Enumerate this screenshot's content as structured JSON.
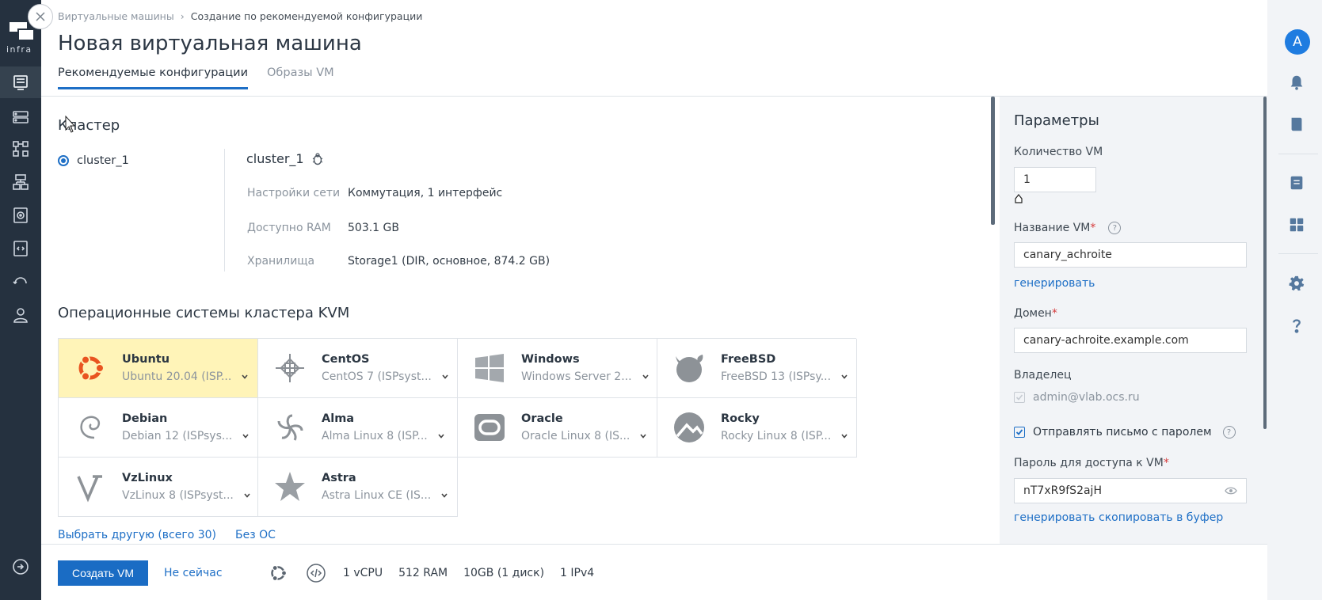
{
  "brand": {
    "logo_text": "infra"
  },
  "left_nav": [
    "vms-icon",
    "servers-icon",
    "network-icon",
    "cluster-icon",
    "images-icon",
    "scripts-icon",
    "backup-icon",
    "users-icon"
  ],
  "breadcrumb": {
    "parent": "Виртуальные машины",
    "separator": "›",
    "current": "Создание по рекомендуемой конфигурации"
  },
  "page_title": "Новая виртуальная машина",
  "tabs": [
    {
      "label": "Рекомендуемые конфигурации",
      "active": true
    },
    {
      "label": "Образы VM",
      "active": false
    }
  ],
  "cluster": {
    "section_title": "Кластер",
    "option_label": "cluster_1",
    "name": "cluster_1",
    "details": [
      {
        "key": "Настройки сети",
        "value": "Коммутация, 1 интерфейс"
      },
      {
        "key": "Доступно RAM",
        "value": "503.1 GB"
      },
      {
        "key": "Хранилища",
        "value": "Storage1 (DIR, основное, 874.2 GB)"
      }
    ]
  },
  "os": {
    "section_title": "Операционные системы кластера KVM",
    "items": [
      {
        "name": "Ubuntu",
        "version": "Ubuntu 20.04 (ISP...",
        "selected": true,
        "icon": "ubuntu-icon"
      },
      {
        "name": "CentOS",
        "version": "CentOS 7 (ISPsyst...",
        "selected": false,
        "icon": "centos-icon"
      },
      {
        "name": "Windows",
        "version": "Windows Server 2...",
        "selected": false,
        "icon": "windows-icon"
      },
      {
        "name": "FreeBSD",
        "version": "FreeBSD 13 (ISPsy...",
        "selected": false,
        "icon": "freebsd-icon"
      },
      {
        "name": "Debian",
        "version": "Debian 12 (ISPsys...",
        "selected": false,
        "icon": "debian-icon"
      },
      {
        "name": "Alma",
        "version": "Alma Linux 8 (ISP...",
        "selected": false,
        "icon": "alma-icon"
      },
      {
        "name": "Oracle",
        "version": "Oracle Linux 8 (IS...",
        "selected": false,
        "icon": "oracle-icon"
      },
      {
        "name": "Rocky",
        "version": "Rocky Linux 8 (ISP...",
        "selected": false,
        "icon": "rocky-icon"
      },
      {
        "name": "VzLinux",
        "version": "VzLinux 8 (ISPsyst...",
        "selected": false,
        "icon": "vzlinux-icon"
      },
      {
        "name": "Astra",
        "version": "Astra Linux CE (IS...",
        "selected": false,
        "icon": "astra-icon"
      }
    ],
    "choose_other": "Выбрать другую (всего 30)",
    "no_os": "Без ОС"
  },
  "params": {
    "title": "Параметры",
    "vm_count_label": "Количество VM",
    "vm_count_value": "1",
    "vm_name_label": "Название VM",
    "vm_name_value": "canary_achroite",
    "generate": "генерировать",
    "domain_label": "Домен",
    "domain_value": "canary-achroite.example.com",
    "owner_label": "Владелец",
    "owner_value": "admin@vlab.ocs.ru",
    "send_mail_label": "Отправлять письмо с паролем",
    "password_label": "Пароль для доступа к VM",
    "password_value": "nT7xR9fS2ajH",
    "copy": "скопировать в буфер",
    "required_mark": "*",
    "help_mark": "?"
  },
  "footer": {
    "create_button": "Создать VM",
    "not_now": "Не сейчас",
    "cpu": "1 vCPU",
    "ram": "512 RAM",
    "disk": "10GB (1 диск)",
    "ip": "1 IPv4"
  },
  "user": {
    "avatar_letter": "A"
  },
  "colors": {
    "accent": "#1e6fc6",
    "sidebar": "#25313f",
    "selected_os": "#fff4b8",
    "required": "#d63b3b"
  }
}
